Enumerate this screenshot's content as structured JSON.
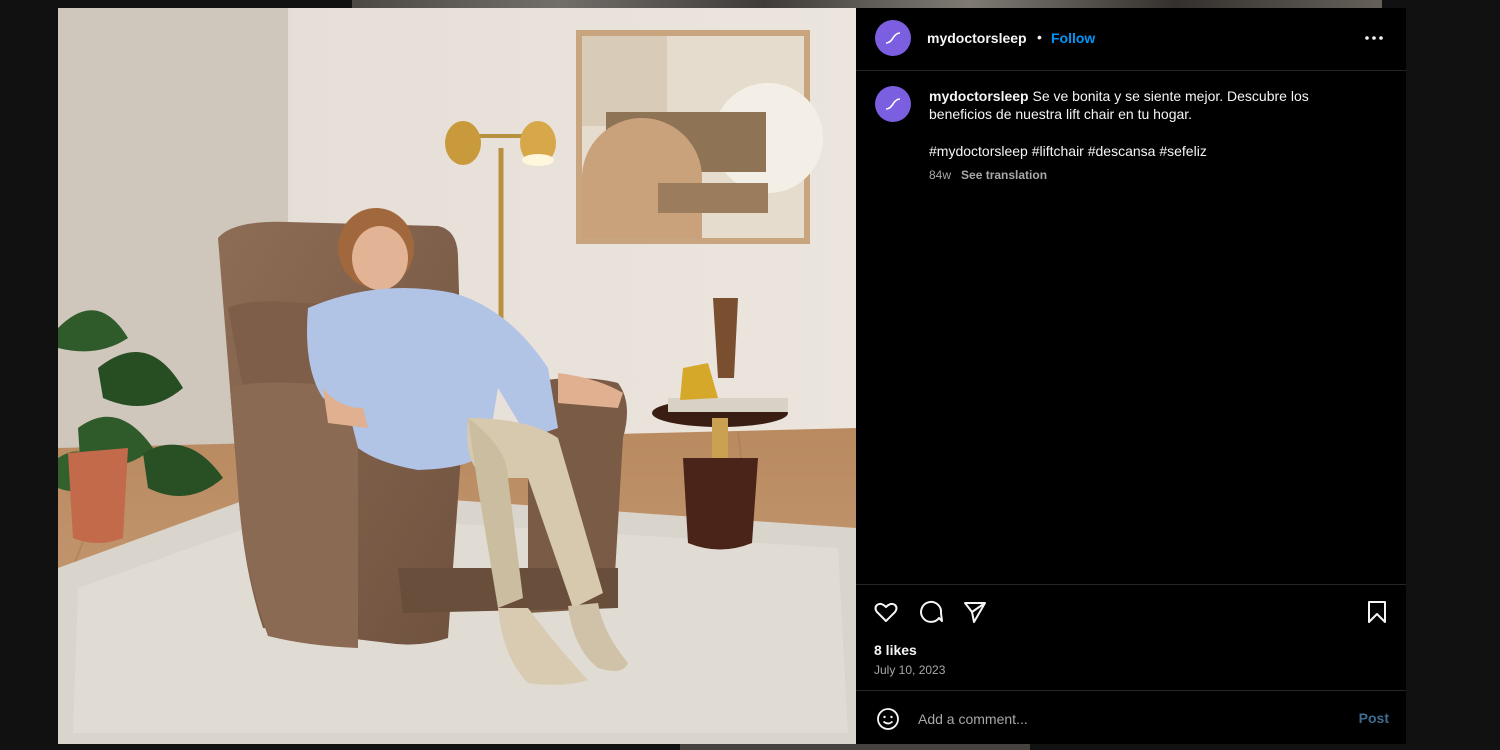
{
  "post": {
    "username": "mydoctorsleep",
    "separator": "•",
    "follow_label": "Follow",
    "caption": "Se ve bonita y se siente mejor. Descubre los beneficios de nuestra lift chair en tu hogar.",
    "hashtags": "#mydoctorsleep #liftchair #descansa #sefeliz",
    "age": "84w",
    "see_translation": "See translation",
    "likes": "8 likes",
    "date": "July 10, 2023"
  },
  "comment": {
    "placeholder": "Add a comment...",
    "post_label": "Post"
  },
  "icons": {
    "more": "more-options-icon",
    "like": "heart-icon",
    "comment": "comment-icon",
    "share": "share-icon",
    "save": "bookmark-icon",
    "emoji": "emoji-icon"
  },
  "colors": {
    "accent": "#0095f6",
    "avatar": "#7b5fe0",
    "background": "#000000"
  }
}
